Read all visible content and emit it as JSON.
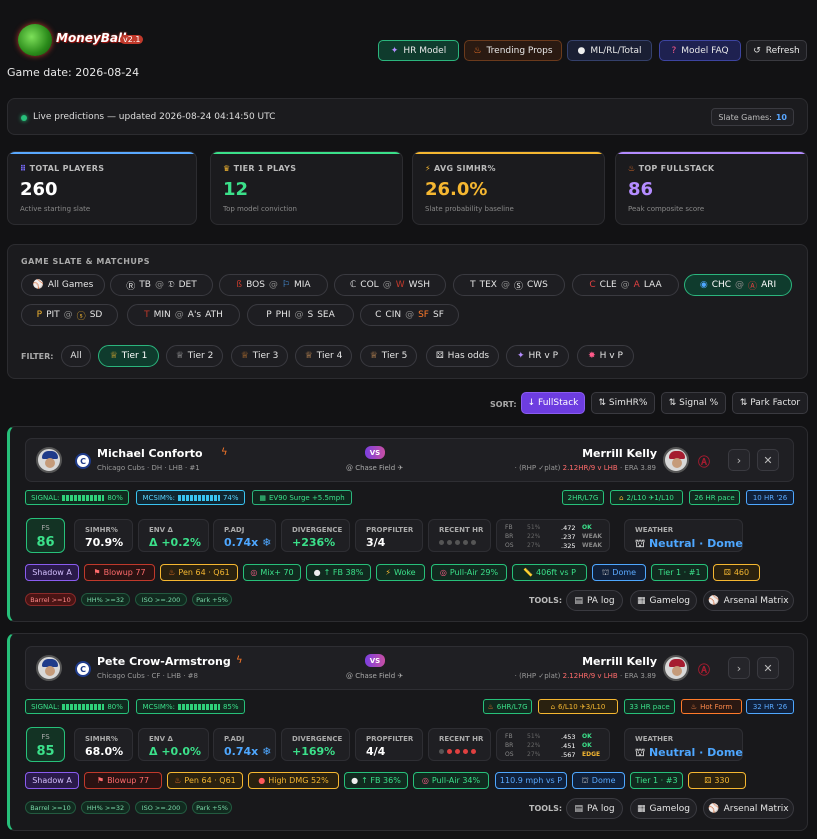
{
  "header": {
    "logo_text": "MoneyBall",
    "logo_version": "v2.1",
    "game_date": "Game date: 2026-08-24",
    "nav": [
      {
        "label": "HR Model",
        "icon": "wand-icon"
      },
      {
        "label": "Trending Props",
        "icon": "fire-icon"
      },
      {
        "label": "ML/RL/Total",
        "icon": "baseball-icon"
      },
      {
        "label": "Model FAQ",
        "icon": "question-icon"
      },
      {
        "label": "Refresh",
        "icon": "refresh-icon"
      }
    ]
  },
  "live": {
    "text": "Live predictions — updated 2026-08-24 04:14:50 UTC",
    "slate_label": "Slate Games:",
    "slate_count": "10"
  },
  "stats": [
    {
      "label": "TOTAL PLAYERS",
      "value": "260",
      "sub": "Active starting slate",
      "color": "#5aa9ff",
      "icon": "users-icon"
    },
    {
      "label": "TIER 1 PLAYS",
      "value": "12",
      "sub": "Top model conviction",
      "color": "#3be08a",
      "icon": "crown-icon"
    },
    {
      "label": "AVG SIMHR%",
      "value": "26.0%",
      "sub": "Slate probability baseline",
      "color": "#f5b731",
      "icon": "bolt-icon"
    },
    {
      "label": "TOP FULLSTACK",
      "value": "86",
      "sub": "Peak composite score",
      "color": "#b48cff",
      "icon": "fire-icon"
    }
  ],
  "slate": {
    "title": "GAME SLATE & MATCHUPS",
    "all_label": "All Games",
    "games": [
      {
        "away": "TB",
        "home": "DET"
      },
      {
        "away": "BOS",
        "home": "MIA"
      },
      {
        "away": "COL",
        "home": "WSH"
      },
      {
        "away": "TEX",
        "home": "CWS"
      },
      {
        "away": "CLE",
        "home": "LAA"
      },
      {
        "away": "CHC",
        "home": "ARI"
      },
      {
        "away": "PIT",
        "home": "SD"
      },
      {
        "away": "MIN",
        "home": "ATH"
      },
      {
        "away": "PHI",
        "home": "SEA"
      },
      {
        "away": "CIN",
        "home": "SF"
      }
    ],
    "at": "@",
    "filter_label": "FILTER:",
    "filters": [
      "All",
      "Tier 1",
      "Tier 2",
      "Tier 3",
      "Tier 4",
      "Tier 5",
      "Has odds",
      "HR v P",
      "H v P"
    ]
  },
  "sort": {
    "label": "SORT:",
    "options": [
      "↓ FullStack",
      "⇅ SimHR%",
      "⇅ Signal %",
      "⇅ Park Factor"
    ]
  },
  "players": [
    {
      "name": "Michael Conforto",
      "meta": "Chicago Cubs · DH · LHB · #1",
      "vs": "VS",
      "venue": "@ Chase Field ✈",
      "pitcher": "Merrill Kelly",
      "pitcher_meta_a": "· (RHP ✓plat) ",
      "pitcher_meta_b": "2.12HR/9 v LHB",
      "pitcher_meta_c": " · ERA 3.89",
      "signal_label": "SIGNAL:",
      "signal": "80%",
      "mcsim_label": "MCSIM%:",
      "mcsim": "74%",
      "ev_tag": "EV90 Surge +5.5mph",
      "right_tags": [
        "2HR/L7G",
        "2/L10 ✈1/L10",
        "26 HR pace",
        "10 HR '26"
      ],
      "fs_label": "FS",
      "fs": "86",
      "simhr_label": "SIMHR%",
      "simhr": "70.9%",
      "env_label": "ENV Δ",
      "env": "Δ +0.2%",
      "padj_label": "P.ADJ",
      "padj": "0.74x ❄",
      "div_label": "DIVERGENCE",
      "div": "+236%",
      "prop_label": "PROPFILTER",
      "prop": "3/4",
      "recent_label": "RECENT HR",
      "splits": [
        {
          "k": "FB",
          "pct": "51%",
          "v": ".472",
          "g": "OK",
          "gc": "#3be08a"
        },
        {
          "k": "BR",
          "pct": "22%",
          "v": ".237",
          "g": "WEAK",
          "gc": "#888"
        },
        {
          "k": "OS",
          "pct": "27%",
          "v": ".325",
          "g": "WEAK",
          "gc": "#888"
        }
      ],
      "weather_label": "WEATHER",
      "weather": "Neutral · Dome",
      "chips": [
        "Shadow A",
        "Blowup 77",
        "Pen 64 · Q61",
        "Mix+ 70",
        "↑ FB 38%",
        "Woke",
        "Pull-Air 29%",
        "406ft vs P",
        "Dome",
        "Tier 1 · #1",
        "460"
      ],
      "minis": [
        "Barrel >=10",
        "HH% >=32",
        "ISO >=.200",
        "Park +5%"
      ],
      "tools_label": "TOOLS:",
      "tools": [
        "PA log",
        "Gamelog",
        "Arsenal Matrix"
      ]
    },
    {
      "name": "Pete Crow-Armstrong",
      "meta": "Chicago Cubs · CF · LHB · #8",
      "vs": "VS",
      "venue": "@ Chase Field ✈",
      "pitcher": "Merrill Kelly",
      "pitcher_meta_a": "· (RHP ✓plat) ",
      "pitcher_meta_b": "2.12HR/9 v LHB",
      "pitcher_meta_c": " · ERA 3.89",
      "signal_label": "SIGNAL:",
      "signal": "80%",
      "mcsim_label": "MCSIM%:",
      "mcsim": "85%",
      "ev_tag": "",
      "right_tags": [
        "6HR/L7G",
        "6/L10 ✈3/L10",
        "33 HR pace",
        "Hot Form",
        "32 HR '26"
      ],
      "fs_label": "FS",
      "fs": "85",
      "simhr_label": "SIMHR%",
      "simhr": "68.0%",
      "env_label": "ENV Δ",
      "env": "Δ +0.0%",
      "padj_label": "P.ADJ",
      "padj": "0.74x ❄",
      "div_label": "DIVERGENCE",
      "div": "+169%",
      "prop_label": "PROPFILTER",
      "prop": "4/4",
      "recent_label": "RECENT HR",
      "splits": [
        {
          "k": "FB",
          "pct": "51%",
          "v": ".453",
          "g": "OK",
          "gc": "#3be08a"
        },
        {
          "k": "BR",
          "pct": "22%",
          "v": ".451",
          "g": "OK",
          "gc": "#3be08a"
        },
        {
          "k": "OS",
          "pct": "27%",
          "v": ".567",
          "g": "EDGE",
          "gc": "#f5b731"
        }
      ],
      "weather_label": "WEATHER",
      "weather": "Neutral · Dome",
      "chips": [
        "Shadow A",
        "Blowup 77",
        "Pen 64 · Q61",
        "High DMG 52%",
        "↑ FB 36%",
        "Pull-Air 34%",
        "110.9 mph vs P",
        "Dome",
        "Tier 1 · #3",
        "330"
      ],
      "minis": [
        "Barrel >=10",
        "HH% >=32",
        "ISO >=.200",
        "Park +5%"
      ],
      "tools_label": "TOOLS:",
      "tools": [
        "PA log",
        "Gamelog",
        "Arsenal Matrix"
      ]
    }
  ]
}
